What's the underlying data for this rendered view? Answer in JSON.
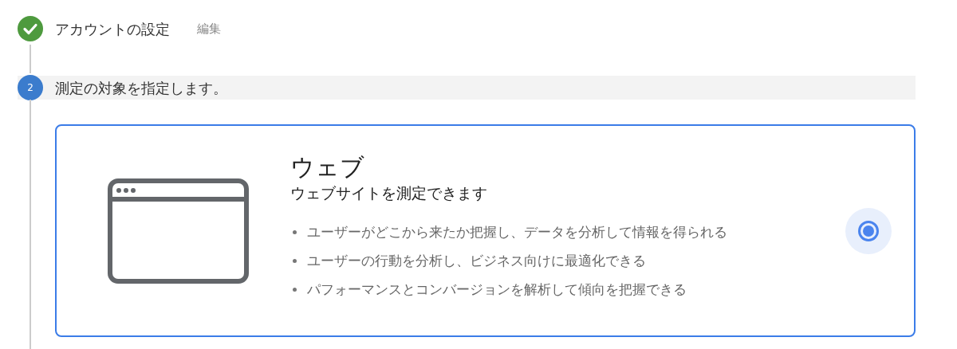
{
  "steps": [
    {
      "kind": "done",
      "label": "アカウントの設定",
      "action": "編集"
    },
    {
      "kind": "current",
      "number": "2",
      "label": "測定の対象を指定します。"
    }
  ],
  "options": [
    {
      "title": "ウェブ",
      "subtitle": "ウェブサイトを測定できます",
      "selected": true,
      "bullets": [
        "ユーザーがどこから来たか把握し、データを分析して情報を得られる",
        "ユーザーの行動を分析し、ビジネス向けに最適化できる",
        "パフォーマンスとコンバージョンを解析して傾向を把握できる"
      ]
    }
  ]
}
